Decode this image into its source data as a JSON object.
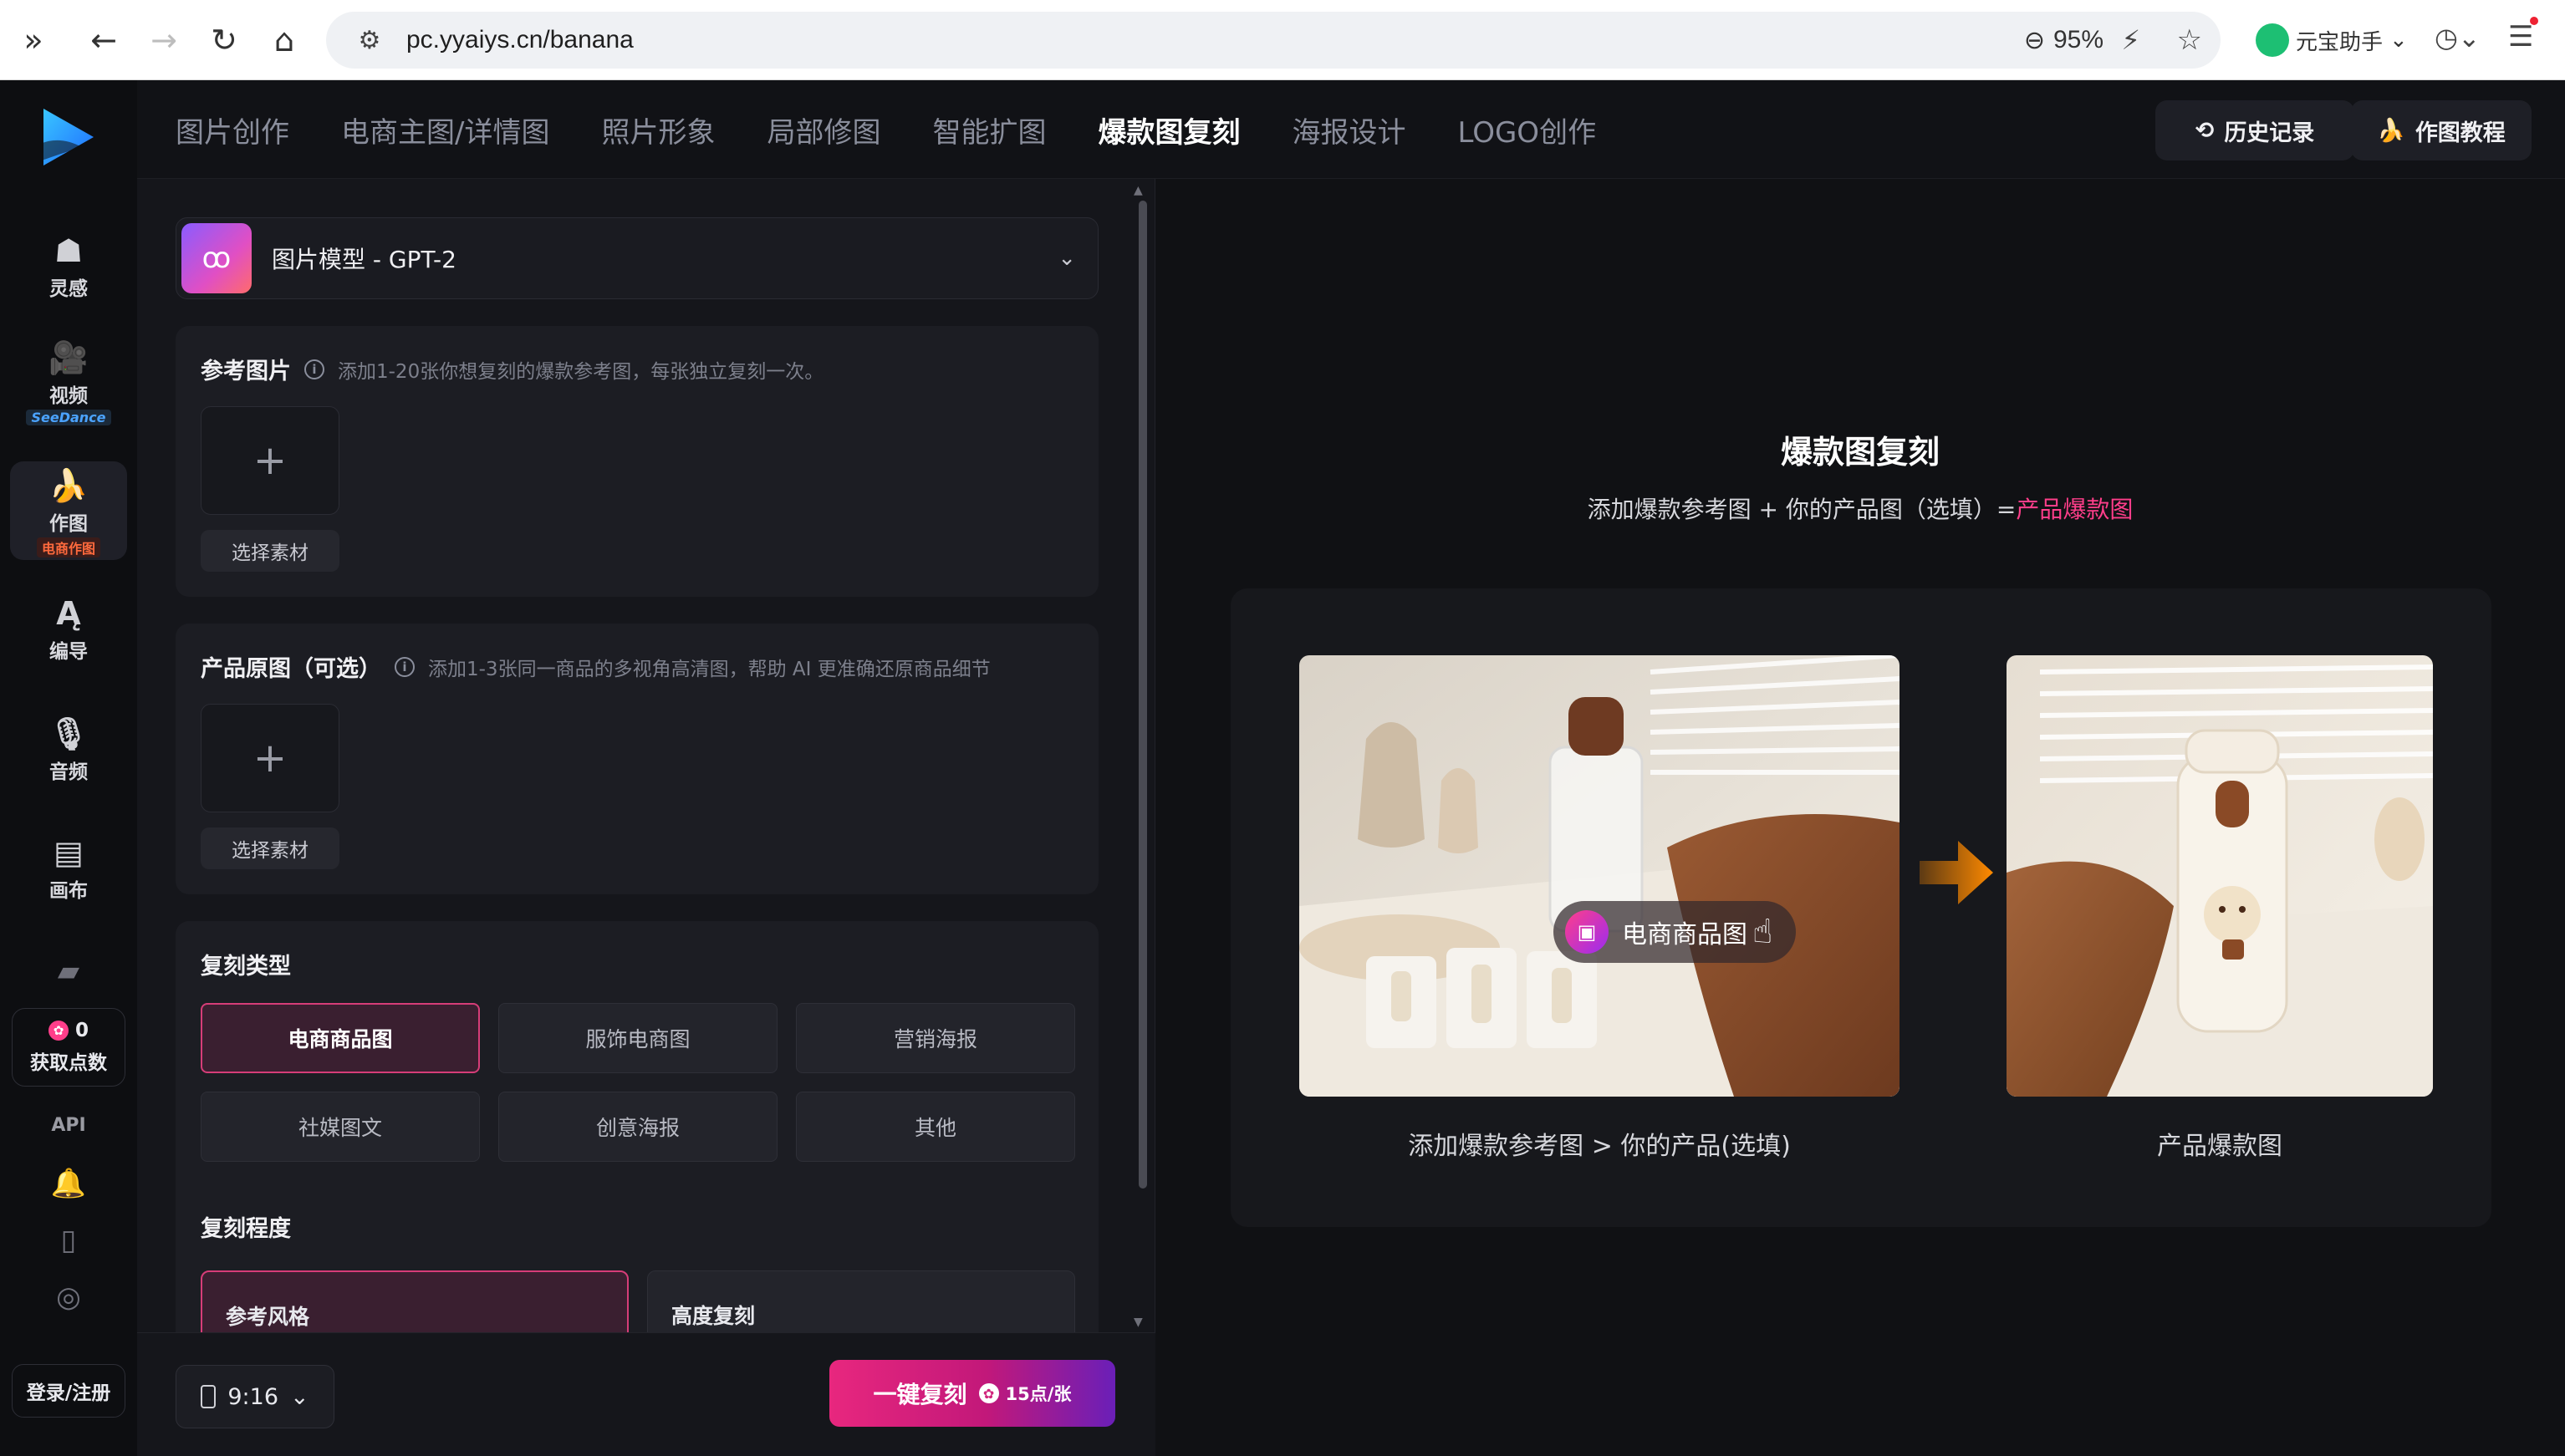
{
  "browser": {
    "url": "pc.yyaiys.cn/banana",
    "zoom": "95%",
    "assistant": "元宝助手"
  },
  "sidebar": {
    "items": [
      {
        "label": "灵感",
        "icon": "inspiration-icon"
      },
      {
        "label": "视频",
        "icon": "video-icon",
        "sub": "SeeDance"
      },
      {
        "label": "作图",
        "icon": "banana-icon",
        "sub": "电商作图"
      },
      {
        "label": "编导",
        "icon": "director-icon"
      },
      {
        "label": "音频",
        "icon": "microphone-icon"
      },
      {
        "label": "画布",
        "icon": "canvas-icon"
      }
    ],
    "points_value": "0",
    "points_label": "获取点数",
    "api_label": "API",
    "login_label": "登录/注册"
  },
  "tabs": [
    {
      "label": "图片创作",
      "active": false
    },
    {
      "label": "电商主图/详情图",
      "active": false
    },
    {
      "label": "照片形象",
      "active": false
    },
    {
      "label": "局部修图",
      "active": false
    },
    {
      "label": "智能扩图",
      "active": false
    },
    {
      "label": "爆款图复刻",
      "active": true
    },
    {
      "label": "海报设计",
      "active": false
    },
    {
      "label": "LOGO创作",
      "active": false
    }
  ],
  "top_buttons": {
    "history": "历史记录",
    "tutorial": "作图教程"
  },
  "model": {
    "label": "图片模型 - GPT-2"
  },
  "reference": {
    "title": "参考图片",
    "hint": "添加1-20张你想复刻的爆款参考图，每张独立复刻一次。",
    "pick": "选择素材"
  },
  "product": {
    "title": "产品原图（可选）",
    "hint": "添加1-3张同一商品的多视角高清图，帮助 AI 更准确还原商品细节",
    "pick": "选择素材"
  },
  "copy_type": {
    "title": "复刻类型",
    "options": [
      "电商商品图",
      "服饰电商图",
      "营销海报",
      "社媒图文",
      "创意海报",
      "其他"
    ],
    "selected": "电商商品图"
  },
  "copy_degree": {
    "title": "复刻程度",
    "options": [
      "参考风格",
      "高度复刻"
    ],
    "selected": "参考风格"
  },
  "footer": {
    "ratio": "9:16",
    "action": "一键复刻",
    "cost": "15点/张"
  },
  "preview": {
    "title": "爆款图复刻",
    "subtitle_prefix": "添加爆款参考图 + 你的产品图（选填）=",
    "subtitle_highlight": "产品爆款图",
    "tag": "电商商品图",
    "caption_left": "添加爆款参考图 > 你的产品(选填)",
    "caption_right": "产品爆款图"
  },
  "colors": {
    "accent": "#ff3e8a",
    "background": "#111216"
  }
}
